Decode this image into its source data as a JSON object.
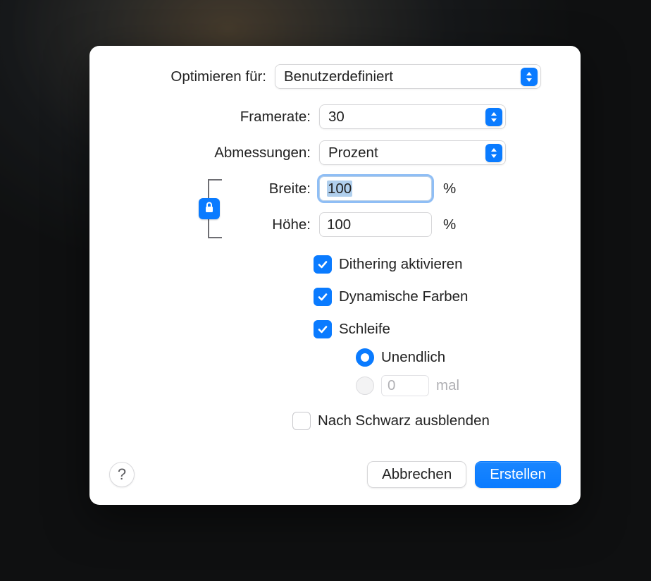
{
  "optimize": {
    "label": "Optimieren für:",
    "value": "Benutzerdefiniert"
  },
  "framerate": {
    "label": "Framerate:",
    "value": "30"
  },
  "dimensions": {
    "label": "Abmessungen:",
    "value": "Prozent"
  },
  "width": {
    "label": "Breite:",
    "value": "100",
    "unit": "%"
  },
  "height": {
    "label": "Höhe:",
    "value": "100",
    "unit": "%"
  },
  "dithering": {
    "label": "Dithering aktivieren",
    "checked": true
  },
  "dynamic_colors": {
    "label": "Dynamische Farben",
    "checked": true
  },
  "loop": {
    "label": "Schleife",
    "checked": true,
    "mode": "infinite",
    "infinite_label": "Unendlich",
    "times_value": "0",
    "times_suffix": "mal"
  },
  "fade_to_black": {
    "label": "Nach Schwarz ausblenden",
    "checked": false
  },
  "buttons": {
    "help": "?",
    "cancel": "Abbrechen",
    "create": "Erstellen"
  },
  "icons": {
    "lock": "lock-icon",
    "updown": "chevron-up-down-icon"
  }
}
